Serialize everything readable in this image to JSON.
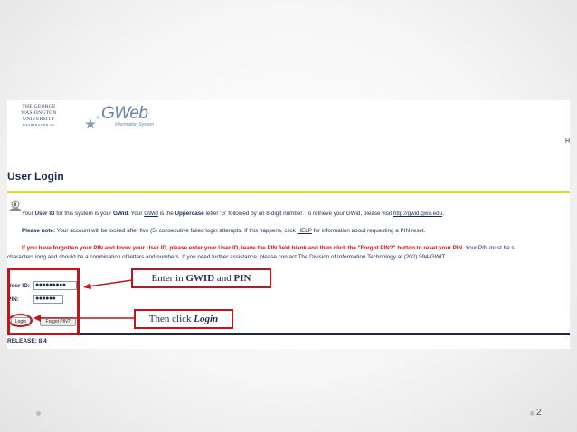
{
  "header": {
    "university_lines": [
      "THE GEORGE",
      "WASHINGTON",
      "UNIVERSITY"
    ],
    "university_sub": "WASHINGTON DC",
    "gweb_word": "GWeb",
    "gweb_tagline": "Information System",
    "edge_text": "H"
  },
  "page_title": "User Login",
  "messages": {
    "gwid_info": {
      "p1": "Your ",
      "b1": "User ID",
      "p2": " for this system is your ",
      "b2": "GWid",
      "p3": ". Your ",
      "link1": "GWid",
      "p4": " is the ",
      "b3": "Uppercase",
      "p5": " letter 'G' followed by an 8-digit number. To retrieve your GWid, please visit ",
      "link2": "http://gwid.gwu.edu",
      "p6": "."
    },
    "note": {
      "label": "Please note:",
      "p1": " Your account will be locked after five (5) consecutive failed login attempts. If this happens, click ",
      "link": "HELP",
      "p2": " for information about requesting a PIN reset."
    },
    "forgot": {
      "red": "If you have forgotten your PIN and know your User ID, please enter your User ID, leave the PIN field blank and then click the \"Forgot PIN?\" button to reset your PIN.",
      "dark": " Your PIN must be s",
      "line2": "characters long and should be a combination of letters and numbers. If you need further assistance, please contact The Division of Information Technology at (202) 994-GWIT."
    }
  },
  "login_form": {
    "userid_label": "User ID:",
    "userid_value": "●●●●●●●●●",
    "pin_label": "PIN:",
    "pin_value": "●●●●●●",
    "login_button": "Login",
    "forgot_button": "Forgot PIN?"
  },
  "release": "RELEASE: 8.4",
  "annotations": {
    "callout1": {
      "pre": "Enter in ",
      "b1": "GWID",
      "mid": " and ",
      "b2": "PIN"
    },
    "callout2": {
      "pre": "Then click ",
      "em": "Login"
    }
  },
  "slide_number": "2",
  "colors": {
    "accent_red": "#c0161b",
    "navy": "#1a2a55",
    "yellow_rule": "#dcd64a"
  }
}
